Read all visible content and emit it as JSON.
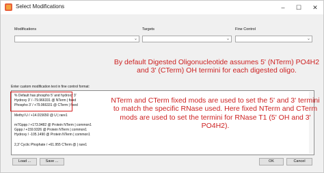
{
  "window": {
    "title": "Select Modifications",
    "controls": {
      "minimize": "–",
      "maximize": "☐",
      "close": "✕"
    }
  },
  "labels": {
    "modifications": "Modifications",
    "targets": "Targets",
    "fine_control": "Fine Control",
    "custom_text": "Enter custom modification text in fine control format:"
  },
  "combos": {
    "modifications_value": "",
    "targets_value": "",
    "fine_control_value": ""
  },
  "editor_lines": [
    "% Default has phospho 5' and hydroxy 3'",
    "Hydroxy 3' / -79.966331 @ NTerm | fixed",
    "Phospho 3' / +79.966331 @ CTerm | fixed",
    "Methyl U / +14.015650 @ U | rare1",
    "m7Gppp / +173.9482 @ Protein NTerm | common1",
    "Gppp / +159.9326 @ Protein NTerm | common1",
    "Hydroxy / -105.1490 @ Protein NTerm | common1",
    "2,3' Cyclic Phophate / +61.955 CTerm @ | rare1"
  ],
  "notes": {
    "note1": "By default Digested Oligonucleotide assumes 5' (NTerm) PO4H2 and 3' (CTerm) OH termini for each digested oligo.",
    "note2": "NTerm and CTerm fixed mods are used to set the 5' and 3' termini to match the specific RNase used. Here fixed NTerm and CTerm mods are used to set the termini for RNase T1 (5' OH and 3' PO4H2)."
  },
  "buttons": {
    "load": "Load ...",
    "save": "Save ...",
    "ok": "OK",
    "cancel": "Cancel"
  },
  "colors": {
    "note_text": "#cc1f1f",
    "highlight_border": "#d42020"
  }
}
